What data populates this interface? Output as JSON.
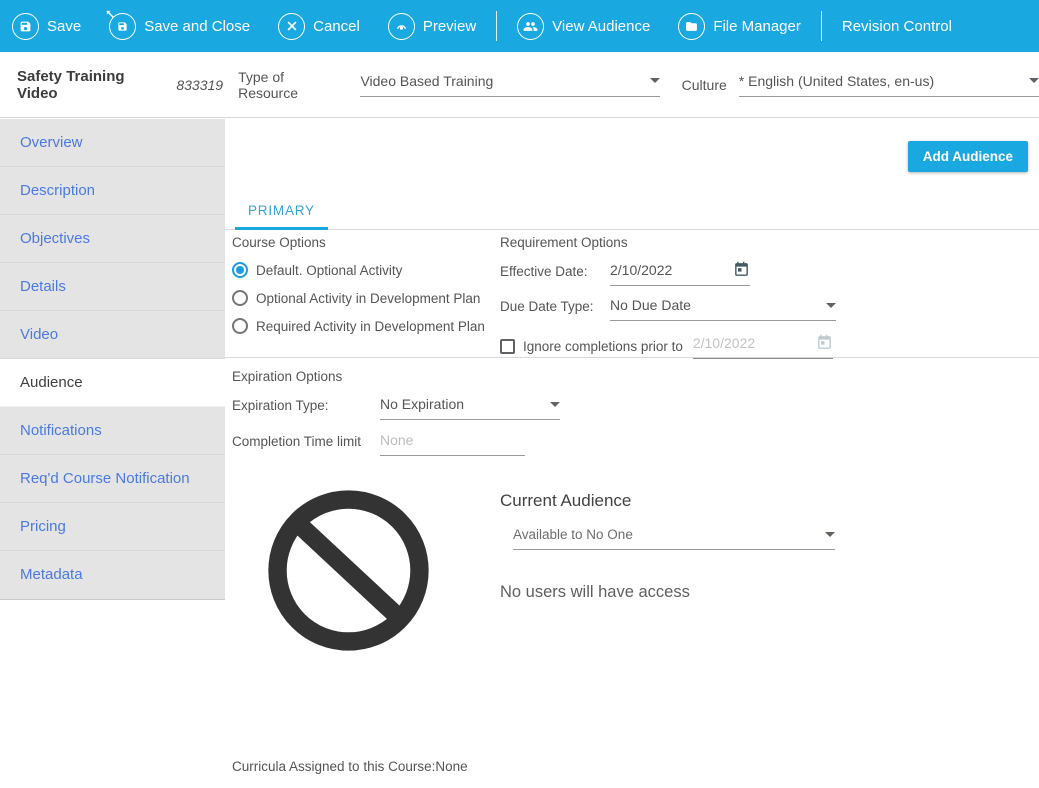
{
  "toolbar": {
    "items": [
      {
        "label": "Save",
        "icon": "save-icon"
      },
      {
        "label": "Save and Close",
        "icon": "save-and-close-icon"
      },
      {
        "label": "Cancel",
        "icon": "cancel-icon"
      },
      {
        "label": "Preview",
        "icon": "preview-icon"
      },
      {
        "label": "View Audience",
        "icon": "view-audience-icon"
      },
      {
        "label": "File Manager",
        "icon": "file-manager-icon"
      },
      {
        "label": "Revision Control",
        "icon": null
      }
    ]
  },
  "header": {
    "title": "Safety Training Video",
    "course_id": "833319",
    "type_label": "Type of Resource",
    "type_value": "Video Based Training",
    "culture_label": "Culture",
    "culture_value": "* English (United States, en-us)"
  },
  "sidebar": {
    "items": [
      {
        "label": "Overview",
        "active": false
      },
      {
        "label": "Description",
        "active": false
      },
      {
        "label": "Objectives",
        "active": false
      },
      {
        "label": "Details",
        "active": false
      },
      {
        "label": "Video",
        "active": false
      },
      {
        "label": "Audience",
        "active": true
      },
      {
        "label": "Notifications",
        "active": false
      },
      {
        "label": "Req'd Course Notification",
        "active": false
      },
      {
        "label": "Pricing",
        "active": false
      },
      {
        "label": "Metadata",
        "active": false
      }
    ]
  },
  "main": {
    "add_audience_button": "Add Audience",
    "tab": "PRIMARY",
    "course_options": {
      "title": "Course Options",
      "options": [
        {
          "label": "Default. Optional Activity",
          "selected": true
        },
        {
          "label": "Optional Activity in Development Plan",
          "selected": false
        },
        {
          "label": "Required Activity in Development Plan",
          "selected": false
        }
      ]
    },
    "requirement_options": {
      "title": "Requirement Options",
      "effective_date_label": "Effective Date:",
      "effective_date_value": "2/10/2022",
      "due_date_type_label": "Due Date Type:",
      "due_date_type_value": "No Due Date",
      "ignore_completions_label": "Ignore completions prior to",
      "ignore_completions_checked": false,
      "ignore_completions_date": "2/10/2022"
    },
    "expiration_options": {
      "title": "Expiration Options",
      "expiration_type_label": "Expiration Type:",
      "expiration_type_value": "No Expiration",
      "completion_time_limit_label": "Completion Time limit",
      "completion_time_limit_placeholder": "None"
    },
    "audience": {
      "heading": "Current Audience",
      "availability_value": "Available to No One",
      "message": "No users will have access",
      "icon": "prohibition-icon"
    },
    "footer_note": "Curricula Assigned to this Course:None"
  },
  "colors": {
    "toolbar_blue": "#1AA8E0",
    "accent_blue": "#1AA8E0",
    "tab_blue": "#35A4D7",
    "sidebar_link_blue": "#4B79E0",
    "radio_selected_blue": "#1B9DDE",
    "sidebar_gray": "#E4E4E4",
    "border_gray": "#D9D9D9",
    "text_gray": "#555555"
  }
}
